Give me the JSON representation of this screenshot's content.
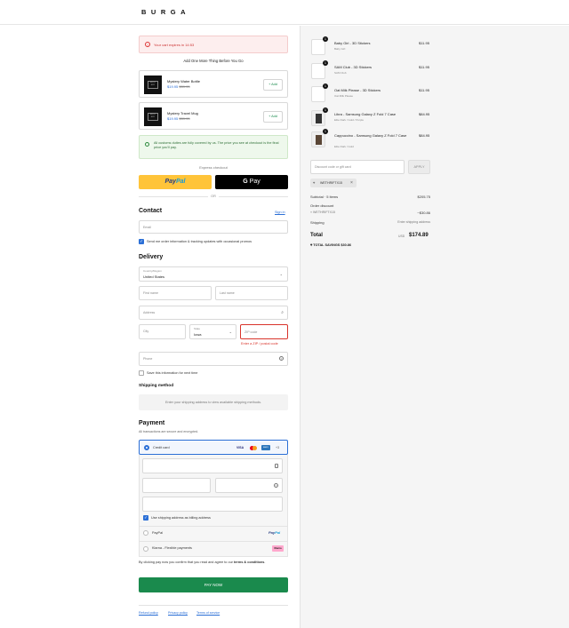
{
  "brand": "BURGA",
  "cart_timer": "Your cart expires in 14:53",
  "upsell": {
    "title": "Add One More Thing Before You Go",
    "items": [
      {
        "name": "Mystery Water Bottle",
        "price": "$19.95",
        "old_price": "$39.95",
        "add_label": "+ Add"
      },
      {
        "name": "Mystery Travel Mug",
        "price": "$19.95",
        "old_price": "$39.95",
        "add_label": "+ Add"
      }
    ]
  },
  "duties_notice": "All customs duties are fully covered by us. The price you see at checkout is the final price you'll pay.",
  "express_checkout": {
    "label": "Express checkout",
    "paypal_a": "Pay",
    "paypal_b": "Pal",
    "gpay_g": "G",
    "gpay_label": "Pay",
    "or": "OR"
  },
  "contact": {
    "title": "Contact",
    "signin": "Sign in",
    "email_placeholder": "Email",
    "newsletter": "Send me order information & tracking updates with occasional promos"
  },
  "delivery": {
    "title": "Delivery",
    "country_label": "Country/Region",
    "country_value": "United States",
    "first_name": "First name",
    "last_name": "Last name",
    "address": "Address",
    "city": "City",
    "state_label": "State",
    "state_value": "Iowa",
    "zip": "ZIP code",
    "zip_error": "Enter a ZIP / postal code",
    "phone": "Phone",
    "save_info": "Save this information for next time"
  },
  "shipping_method": {
    "title": "Shipping method",
    "placeholder": "Enter your shipping address to view available shipping methods."
  },
  "payment": {
    "title": "Payment",
    "subtitle": "All transactions are secure and encrypted.",
    "credit_card": "Credit card",
    "visa": "VISA",
    "amex": "AMEX",
    "more_cards": "+3",
    "billing_same": "Use shipping address as billing address",
    "paypal": "PayPal",
    "paypal_logo_a": "Pay",
    "paypal_logo_b": "Pal",
    "klarna": "Klarna - Flexible payments",
    "klarna_logo": "Klarna"
  },
  "terms": {
    "text_a": "By clicking pay now you confirm that you read and agree to our ",
    "link": "terms & conditions",
    "text_b": "."
  },
  "pay_now": "PAY NOW",
  "footer": {
    "refund": "Refund policy",
    "privacy": "Privacy policy",
    "tos": "Terms of service"
  },
  "summary": {
    "items": [
      {
        "qty": "1",
        "name": "Baby Girl - 3D Stickers",
        "variant": "Baby Girl",
        "price": "$11.95"
      },
      {
        "qty": "1",
        "name": "SAM Club - 3D Stickers",
        "variant": "SAM Club",
        "price": "$11.95"
      },
      {
        "qty": "1",
        "name": "Oat Milk Please - 3D Stickers",
        "variant": "Oat Milk Please",
        "price": "$11.95"
      },
      {
        "qty": "1",
        "name": "Libra - Samsung Galaxy Z Fold 7 Case",
        "variant": "Elite Dark / Gold / Purple",
        "price": "$84.95"
      },
      {
        "qty": "1",
        "name": "Cappuccino - Samsung Galaxy Z Fold 7 Case",
        "variant": "Elite Dark / Gold",
        "price": "$84.95"
      }
    ],
    "discount_placeholder": "Discount code or gift card",
    "apply": "APPLY",
    "applied_code": "WETHRIFTX15",
    "subtotal_label": "Subtotal · 5 items",
    "subtotal": "$205.75",
    "order_discount_label": "Order discount",
    "discount_code": "WETHRIFTX15",
    "discount_value": "−$30.86",
    "shipping_label": "Shipping",
    "shipping_value": "Enter shipping address",
    "total_label": "Total",
    "currency": "USD",
    "total": "$174.89",
    "savings_label": "TOTAL SAVINGS",
    "savings": "$30.86"
  }
}
